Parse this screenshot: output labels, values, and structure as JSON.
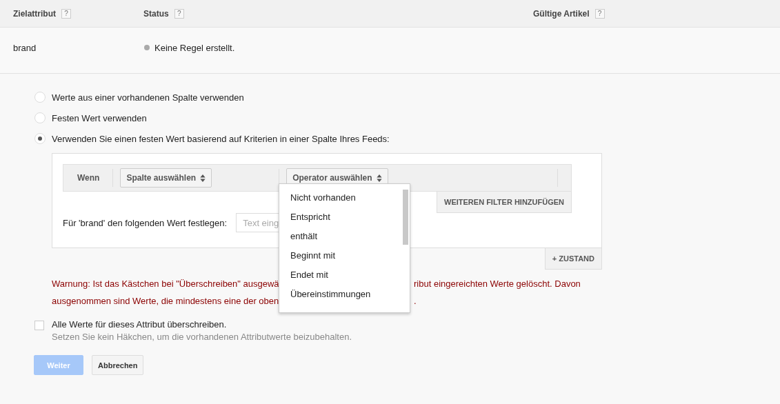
{
  "table": {
    "columns": [
      {
        "label": "Zielattribut",
        "help": "?"
      },
      {
        "label": "Status",
        "help": "?"
      },
      {
        "label": "Gültige Artikel",
        "help": "?"
      }
    ],
    "row": {
      "attribute": "brand",
      "status": "Keine Regel erstellt."
    }
  },
  "options": [
    {
      "label": "Werte aus einer vorhandenen Spalte verwenden",
      "selected": false
    },
    {
      "label": "Festen Wert verwenden",
      "selected": false
    },
    {
      "label": "Verwenden Sie einen festen Wert basierend auf Kriterien in einer Spalte Ihres Feeds:",
      "selected": true
    }
  ],
  "filter": {
    "label": "Wenn",
    "column_select": "Spalte auswählen",
    "operator_select": "Operator auswählen",
    "add_filter": "WEITEREN FILTER HINZUFÜGEN",
    "value_label": "Für 'brand' den folgenden Wert festlegen:",
    "value_placeholder": "Text eing",
    "add_condition": "+ ZUSTAND"
  },
  "dropdown": {
    "items": [
      "Nicht vorhanden",
      "Entspricht",
      "enthält",
      "Beginnt mit",
      "Endet mit",
      "Übereinstimmungen"
    ]
  },
  "warning": [
    {
      "left": "Warnung: Ist das Kästchen bei \"Überschreiben\" ausgewä",
      "right": "ribut eingereichten Werte gelöscht. Davon"
    },
    {
      "left": "ausgenommen sind Werte, die mindestens eine der oben",
      "right": "."
    }
  ],
  "overwrite": {
    "label": "Alle Werte für dieses Attribut überschreiben.",
    "hint": "Setzen Sie kein Häkchen, um die vorhandenen Attributwerte beizubehalten.",
    "checked": false
  },
  "buttons": [
    {
      "label": "Weiter",
      "kind": "primary",
      "disabled": true
    },
    {
      "label": "Abbrechen",
      "kind": "secondary",
      "disabled": false
    }
  ]
}
